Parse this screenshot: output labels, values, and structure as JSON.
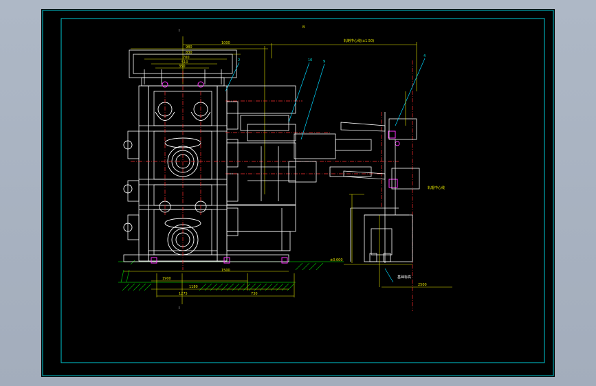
{
  "drawing": {
    "colors": {
      "background": "#000000",
      "frame": "#00c8d2",
      "geometry": "#ffffff",
      "dimension": "#e6e600",
      "leader": "#00d7ff",
      "centerline": "#ff3030",
      "highlight": "#ff33ff",
      "hatch": "#00b400"
    },
    "labels": {
      "top_center": "B",
      "section_top": "I",
      "section_bottom": "I",
      "dim_1": "1000",
      "dim_2": "980",
      "dim_3": "830",
      "dim_4": "700",
      "dim_5": "510",
      "dim_6": "350",
      "dim_7": "1900",
      "dim_8": "1180",
      "dim_9": "1275",
      "dim_10": "730",
      "dim_11": "1500",
      "dim_12": "2500",
      "callout_1": "2",
      "callout_2": "10",
      "callout_3": "9",
      "callout_4": "4",
      "right_note": "轧辊中心线",
      "floor_note": "±0.000",
      "bottom_note": "基础标高",
      "top_note": "轧制中心线(±1.50)"
    }
  }
}
